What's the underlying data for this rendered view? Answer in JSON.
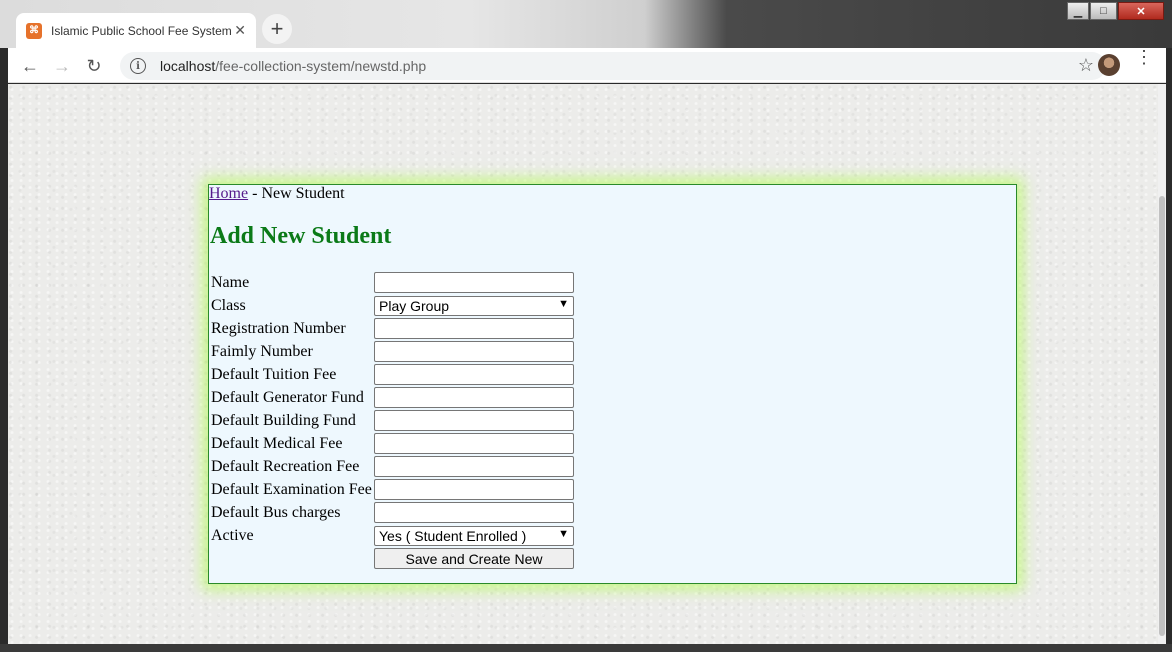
{
  "browser": {
    "tab_title": "Islamic Public School Fee System",
    "tab_close": "✕",
    "new_tab": "+",
    "url_host": "localhost",
    "url_path": "/fee-collection-system/newstd.php",
    "favicon_glyph": "⌘"
  },
  "window_controls": {
    "minimize": "▁",
    "maximize": "□",
    "close": "✕"
  },
  "icons": {
    "back": "←",
    "forward": "→",
    "reload": "↻",
    "info": "i",
    "star": "☆",
    "menu": "⋮"
  },
  "page": {
    "breadcrumb_home": "Home",
    "breadcrumb_sep": " - ",
    "breadcrumb_current": "New Student",
    "title": "Add New Student",
    "title_color": "#0b7a18"
  },
  "form": {
    "name_label": "Name",
    "name_value": "",
    "class_label": "Class",
    "class_value": "Play Group",
    "registration_label": "Registration Number",
    "registration_value": "",
    "family_label": "Faimly Number",
    "family_value": "",
    "tuition_label": "Default Tuition Fee",
    "tuition_value": "",
    "generator_label": "Default Generator Fund",
    "generator_value": "",
    "building_label": "Default Building Fund",
    "building_value": "",
    "medical_label": "Default Medical Fee",
    "medical_value": "",
    "recreation_label": "Default Recreation Fee",
    "recreation_value": "",
    "examination_label": "Default Examination Fee",
    "examination_value": "",
    "bus_label": "Default Bus charges",
    "bus_value": "",
    "active_label": "Active",
    "active_value": "Yes ( Student Enrolled )",
    "submit_label": "Save and Create New",
    "select_chevron": "▼"
  }
}
